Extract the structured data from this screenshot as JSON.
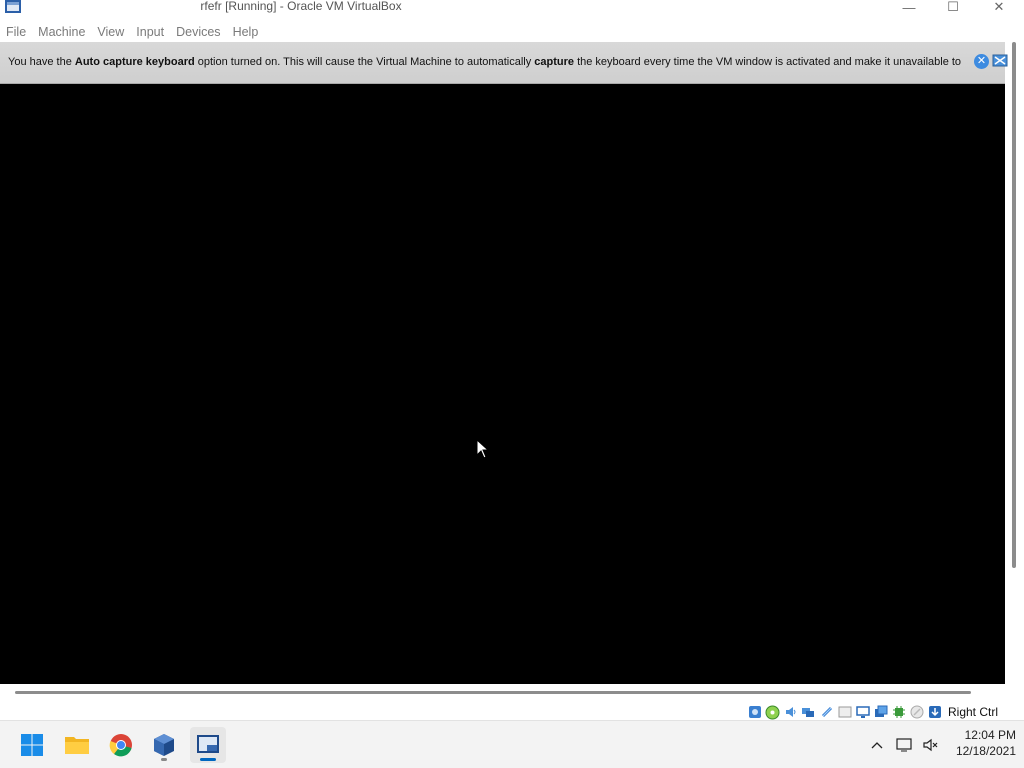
{
  "window": {
    "title": "rfefr [Running] - Oracle VM VirtualBox",
    "controls": {
      "minimize": "—",
      "maximize": "☐",
      "close": "✕"
    }
  },
  "menu": [
    "File",
    "Machine",
    "View",
    "Input",
    "Devices",
    "Help"
  ],
  "notice": {
    "part1": "You have the ",
    "bold1": "Auto capture keyboard",
    "part2": " option turned on. This will cause the Virtual Machine to automatically ",
    "bold2": "capture",
    "part3": " the keyboard every time the VM window is activated and make it unavailable to"
  },
  "statusbar": {
    "icons": [
      "hard-disk-icon",
      "optical-drive-icon",
      "audio-icon",
      "network-icon",
      "usb-icon",
      "shared-folders-icon",
      "display-icon",
      "video-capture-icon",
      "cpu-icon",
      "mouse-integration-icon",
      "keyboard-capture-icon"
    ],
    "host_key": "Right Ctrl"
  },
  "taskbar": {
    "apps": [
      "start-icon",
      "file-explorer-icon",
      "chrome-icon",
      "virtualbox-manager-icon",
      "virtualbox-vm-icon"
    ],
    "tray_icons": [
      "show-hidden-icons-chevron",
      "network-icon",
      "volume-muted-icon"
    ]
  },
  "clock": {
    "time": "12:04 PM",
    "date": "12/18/2021"
  },
  "colors": {
    "accent": "#0067c0",
    "vm_background": "#000000",
    "notice_background": "#d4d4d4"
  }
}
